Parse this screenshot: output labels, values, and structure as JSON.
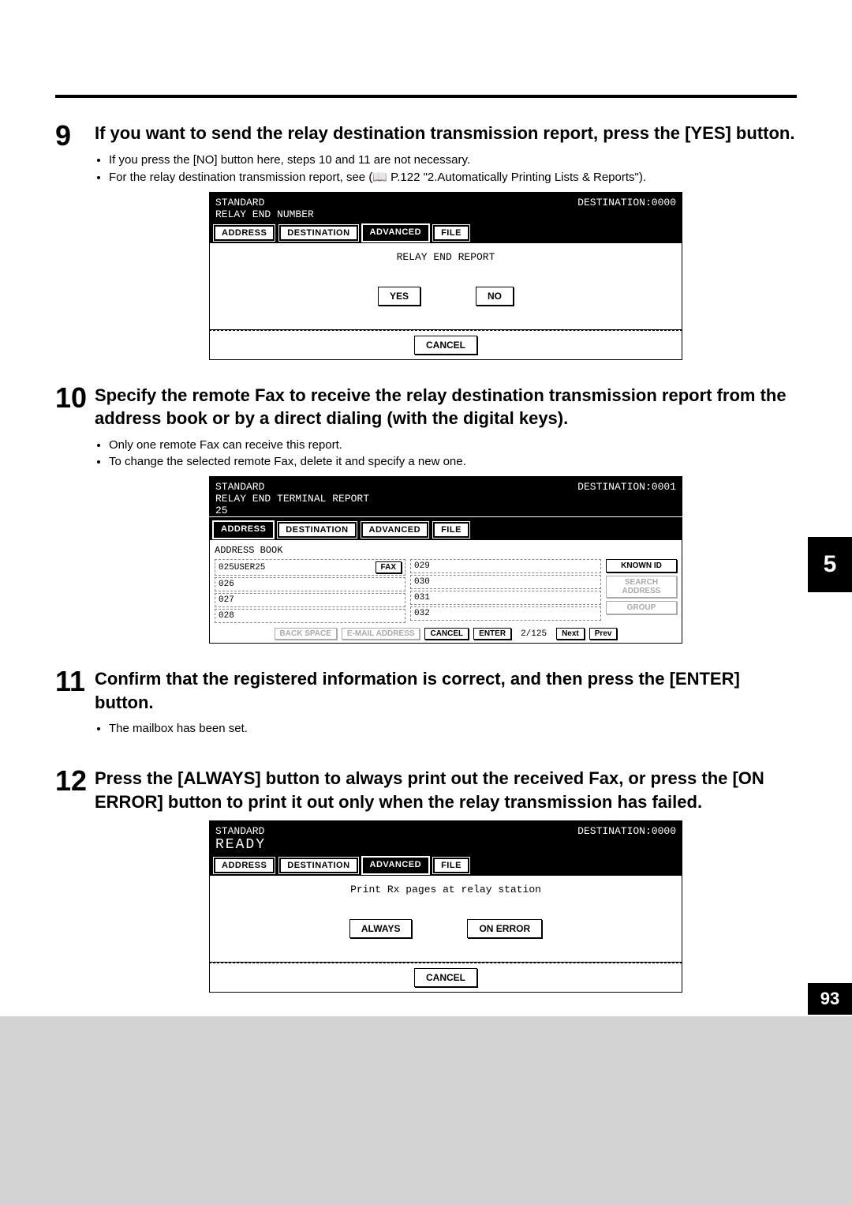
{
  "sideTab": "5",
  "pageNumber": "93",
  "steps": {
    "s9": {
      "num": "9",
      "title": "If you want to send the relay destination transmission report, press the [YES] button.",
      "bullets": [
        "If you press the [NO] button here, steps 10 and 11 are not necessary.",
        "For the relay destination transmission report, see (📖  P.122 \"2.Automatically Printing Lists & Reports\")."
      ],
      "screen": {
        "standard": "STANDARD",
        "dest": "DESTINATION:0000",
        "sub": "RELAY END NUMBER",
        "tabs": {
          "address": "ADDRESS",
          "destination": "DESTINATION",
          "advanced": "ADVANCED",
          "file": "FILE"
        },
        "bodyMsg": "RELAY END REPORT",
        "yes": "YES",
        "no": "NO",
        "cancel": "CANCEL"
      }
    },
    "s10": {
      "num": "10",
      "title": "Specify the remote Fax to receive the relay destination transmission report from the address book or by a direct dialing (with the digital keys).",
      "bullets": [
        "Only one remote Fax can receive this report.",
        "To change the selected remote Fax, delete it and specify a new one."
      ],
      "screen": {
        "standard": "STANDARD",
        "dest": "DESTINATION:0001",
        "sub": "RELAY END TERMINAL REPORT",
        "input": "25",
        "tabs": {
          "address": "ADDRESS",
          "destination": "DESTINATION",
          "advanced": "ADVANCED",
          "file": "FILE"
        },
        "abookTitle": "ADDRESS BOOK",
        "colA": [
          {
            "label": "025USER25",
            "tag": "FAX"
          },
          {
            "label": "026"
          },
          {
            "label": "027"
          },
          {
            "label": "028"
          }
        ],
        "colB": [
          {
            "label": "029"
          },
          {
            "label": "030"
          },
          {
            "label": "031"
          },
          {
            "label": "032"
          }
        ],
        "side": {
          "known": "KNOWN ID",
          "search": "SEARCH ADDRESS",
          "group": "GROUP"
        },
        "bottom": {
          "backspace": "BACK SPACE",
          "email": "E-MAIL ADDRESS",
          "cancel": "CANCEL",
          "enter": "ENTER",
          "pager": "2/125",
          "next": "Next",
          "prev": "Prev"
        }
      }
    },
    "s11": {
      "num": "11",
      "title": "Confirm that the registered information is correct, and then press the [ENTER] button.",
      "bullets": [
        "The mailbox has been set."
      ]
    },
    "s12": {
      "num": "12",
      "title": "Press the [ALWAYS] button to always print out the received Fax, or press the [ON ERROR] button to print it out only when the relay transmission has failed.",
      "screen": {
        "standard": "STANDARD",
        "dest": "DESTINATION:0000",
        "ready": "READY",
        "tabs": {
          "address": "ADDRESS",
          "destination": "DESTINATION",
          "advanced": "ADVANCED",
          "file": "FILE"
        },
        "bodyMsg": "Print Rx pages at relay station",
        "always": "ALWAYS",
        "onerror": "ON ERROR",
        "cancel": "CANCEL"
      }
    }
  }
}
